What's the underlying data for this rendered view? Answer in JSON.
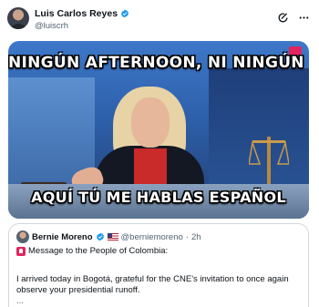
{
  "author": {
    "name": "Luis Carlos Reyes",
    "handle": "@luiscrh"
  },
  "media": {
    "caption_top": "NINGÚN AFTERNOON, NI NINGÚN HELLO",
    "caption_bottom": "AQUÍ TÚ ME HABLAS ESPAÑOL"
  },
  "quoted_post": {
    "name": "Bernie Moreno",
    "handle": "@berniemoreno",
    "separator": "·",
    "time": "2h",
    "line1": "Message to the People of Colombia:",
    "paragraph": "I arrived today in Bogotá, grateful for the CNE's invitation to once again observe your presidential runoff.",
    "more": "..."
  },
  "icons": {
    "verified": "verified-badge-icon",
    "grok": "grok-icon",
    "more": "more-options-icon",
    "siren": "siren-emoji-icon",
    "flag": "us-flag-emoji-icon"
  },
  "colors": {
    "verified": "#1d9bf0",
    "handle": "#536471",
    "border": "#cfd9de",
    "accent": "#e0245e"
  }
}
